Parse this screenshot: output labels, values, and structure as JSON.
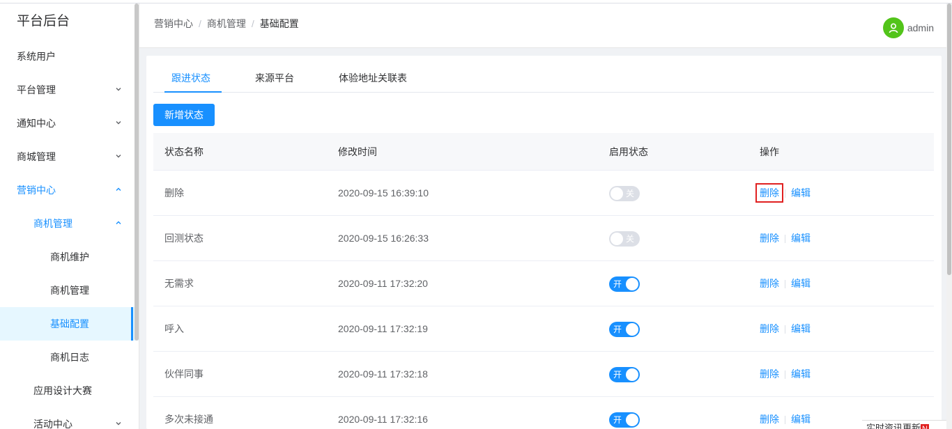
{
  "app": {
    "title": "平台后台"
  },
  "sidebar": {
    "items": [
      {
        "label": "系统用户",
        "level": 1,
        "arrow": ""
      },
      {
        "label": "平台管理",
        "level": 1,
        "arrow": "chevron-down"
      },
      {
        "label": "通知中心",
        "level": 1,
        "arrow": "chevron-down"
      },
      {
        "label": "商城管理",
        "level": 1,
        "arrow": "chevron-down"
      },
      {
        "label": "营销中心",
        "level": 1,
        "arrow": "chevron-up"
      },
      {
        "label": "商机管理",
        "level": 2,
        "arrow": "chevron-up"
      },
      {
        "label": "商机维护",
        "level": 3,
        "arrow": ""
      },
      {
        "label": "商机管理",
        "level": 3,
        "arrow": ""
      },
      {
        "label": "基础配置",
        "level": 3,
        "arrow": ""
      },
      {
        "label": "商机日志",
        "level": 3,
        "arrow": ""
      },
      {
        "label": "应用设计大赛",
        "level": 2,
        "arrow": ""
      },
      {
        "label": "活动中心",
        "level": 2,
        "arrow": "chevron-down"
      }
    ],
    "active": "基础配置"
  },
  "header": {
    "breadcrumb": [
      "营销中心",
      "商机管理",
      "基础配置"
    ],
    "separator": "/",
    "user": "admin"
  },
  "tabs": [
    "跟进状态",
    "来源平台",
    "体验地址关联表"
  ],
  "toolbar": {
    "add_label": "新增状态"
  },
  "table": {
    "columns": [
      "状态名称",
      "修改时间",
      "启用状态",
      "操作"
    ],
    "rows": [
      {
        "name": "删除",
        "time": "2020-09-15 16:39:10",
        "enabled": false,
        "switch_text": "关"
      },
      {
        "name": "回测状态",
        "time": "2020-09-15 16:26:33",
        "enabled": false,
        "switch_text": "关"
      },
      {
        "name": "无需求",
        "time": "2020-09-11 17:32:20",
        "enabled": true,
        "switch_text": "开"
      },
      {
        "name": "呼入",
        "time": "2020-09-11 17:32:19",
        "enabled": true,
        "switch_text": "开"
      },
      {
        "name": "伙伴同事",
        "time": "2020-09-11 17:32:18",
        "enabled": true,
        "switch_text": "开"
      },
      {
        "name": "多次未接通",
        "time": "2020-09-11 17:32:16",
        "enabled": true,
        "switch_text": "开"
      }
    ],
    "actions": {
      "delete": "删除",
      "edit": "编辑"
    }
  },
  "news": {
    "label": "实时资讯更新",
    "badge": "N"
  },
  "colors": {
    "accent": "#1890ff",
    "avatar": "#52c41a",
    "highlight": "#e02020"
  }
}
